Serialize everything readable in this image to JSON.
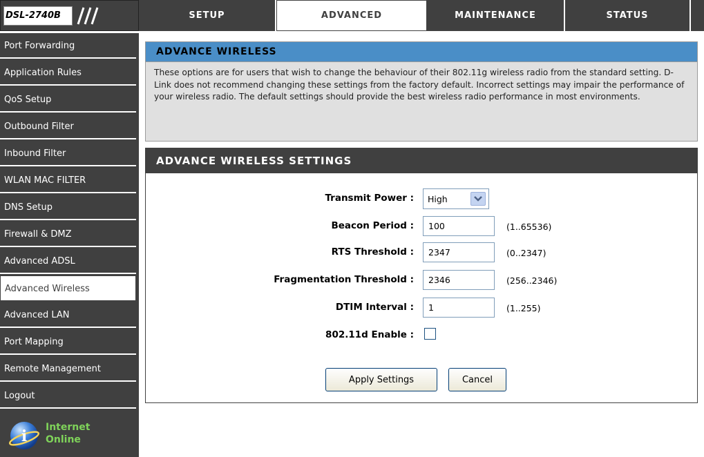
{
  "header": {
    "model": "DSL-2740B",
    "tabs": [
      {
        "label": "SETUP"
      },
      {
        "label": "ADVANCED"
      },
      {
        "label": "MAINTENANCE"
      },
      {
        "label": "STATUS"
      }
    ],
    "active_tab": "ADVANCED"
  },
  "sidebar": {
    "items": [
      {
        "label": "Port Forwarding"
      },
      {
        "label": "Application Rules"
      },
      {
        "label": "QoS Setup"
      },
      {
        "label": "Outbound Filter"
      },
      {
        "label": "Inbound Filter"
      },
      {
        "label": "WLAN MAC FILTER"
      },
      {
        "label": "DNS Setup"
      },
      {
        "label": "Firewall & DMZ"
      },
      {
        "label": "Advanced ADSL"
      },
      {
        "label": "Advanced Wireless"
      },
      {
        "label": "Advanced LAN"
      },
      {
        "label": "Port Mapping"
      },
      {
        "label": "Remote Management"
      },
      {
        "label": "Logout"
      }
    ],
    "active_item": "Advanced Wireless",
    "status": {
      "line1": "Internet",
      "line2": "Online",
      "icon": "globe-info-icon"
    }
  },
  "info": {
    "title": "ADVANCE WIRELESS",
    "text": "These options are for users that wish to change the behaviour of their 802.11g wireless radio from the standard setting. D-Link does not recommend changing these settings from the factory default. Incorrect settings may impair the performance of your wireless radio. The default settings should provide the best wireless radio performance in most environments."
  },
  "settings": {
    "title": "ADVANCE WIRELESS SETTINGS",
    "transmit_power": {
      "label": "Transmit Power :",
      "value": "High"
    },
    "beacon_period": {
      "label": "Beacon Period :",
      "value": "100",
      "range": "(1..65536)"
    },
    "rts_threshold": {
      "label": "RTS Threshold :",
      "value": "2347",
      "range": "(0..2347)"
    },
    "frag_threshold": {
      "label": "Fragmentation Threshold :",
      "value": "2346",
      "range": "(256..2346)"
    },
    "dtim_interval": {
      "label": "DTIM Interval :",
      "value": "1",
      "range": "(1..255)"
    },
    "dot11d": {
      "label": "802.11d Enable :",
      "checked": false
    },
    "apply_label": "Apply Settings",
    "cancel_label": "Cancel"
  },
  "colors": {
    "dark_gray": "#404040",
    "info_header_blue": "#4a8ec7",
    "info_bg": "#e0e0e0",
    "status_green": "#7fd35a"
  }
}
